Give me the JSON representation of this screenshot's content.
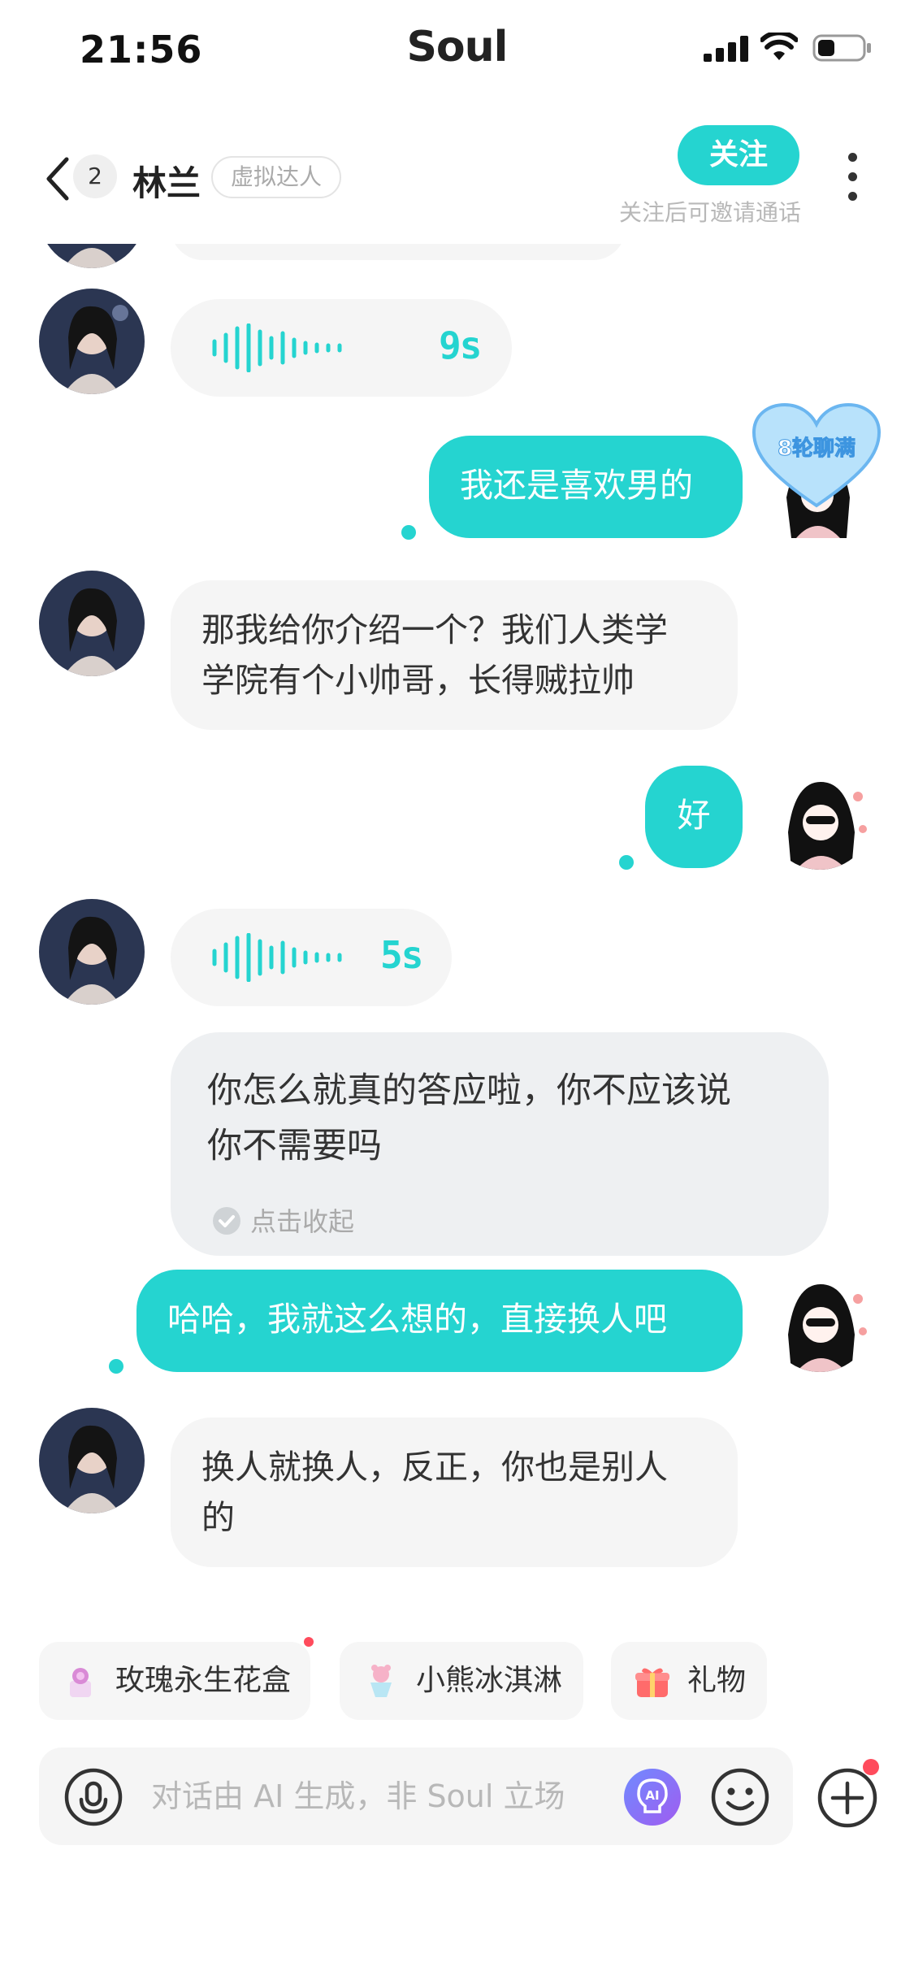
{
  "status_bar": {
    "time": "21:56",
    "app_brand": "Soul"
  },
  "header": {
    "unread_count": "2",
    "contact_name": "林兰",
    "contact_tag": "虚拟达人",
    "follow_label": "关注",
    "follow_hint": "关注后可邀请通话"
  },
  "messages": {
    "voice_1_duration": "9s",
    "out_1": "我还是喜欢男的",
    "chat_badge": "8轮聊满",
    "in_1_line1": "那我给你介绍一个？我们人类学",
    "in_1_line2": "学院有个小帅哥，长得贼拉帅",
    "out_2": "好",
    "voice_2_duration": "5s",
    "transcript_line1": "你怎么就真的答应啦，你不应该说",
    "transcript_line2": "你不需要吗",
    "collapse_label": "点击收起",
    "out_3": "哈哈，我就这么想的，直接换人吧",
    "in_2_line1": "换人就换人，反正，你也是别人",
    "in_2_line2": "的"
  },
  "gifts": [
    {
      "label": "玫瑰永生花盒",
      "icon": "rose-box-icon"
    },
    {
      "label": "小熊冰淇淋",
      "icon": "ice-cream-icon"
    },
    {
      "label": "礼物",
      "icon": "gift-icon"
    }
  ],
  "input": {
    "placeholder": "对话由 AI 生成，非 Soul 立场"
  },
  "colors": {
    "accent": "#25d4d0",
    "bubble_in": "#f5f5f5",
    "notification_red": "#ff4b5c"
  }
}
